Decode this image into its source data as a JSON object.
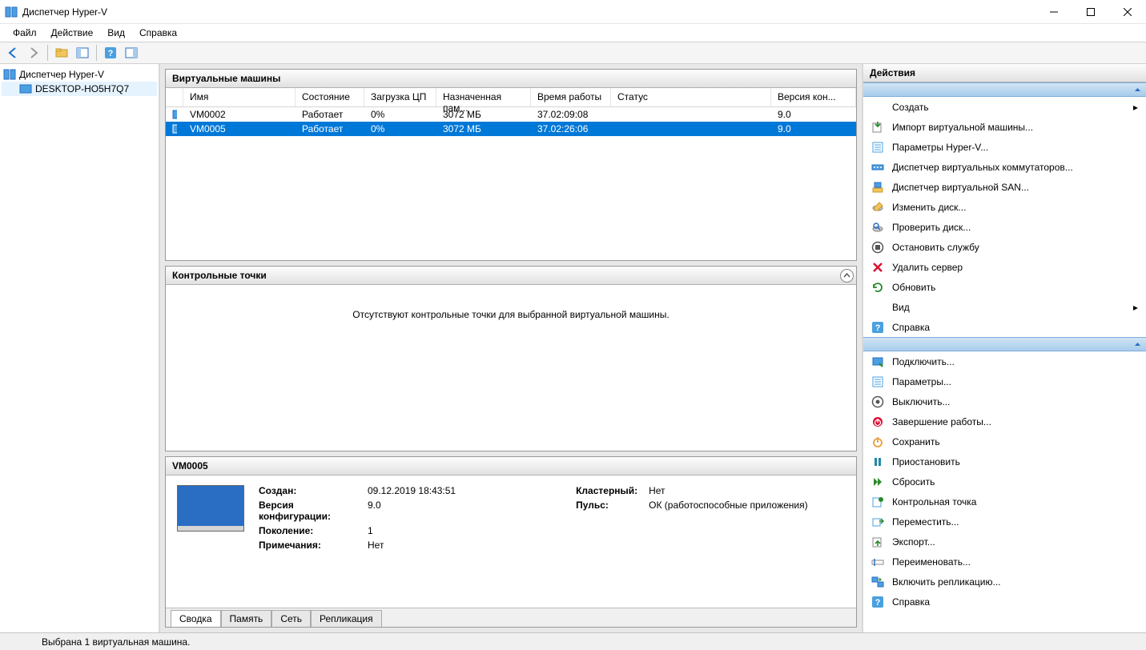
{
  "window": {
    "title": "Диспетчер Hyper-V"
  },
  "menu": {
    "file": "Файл",
    "action": "Действие",
    "view": "Вид",
    "help": "Справка"
  },
  "tree": {
    "root": "Диспетчер Hyper-V",
    "host": "DESKTOP-HO5H7Q7"
  },
  "vm_panel": {
    "title": "Виртуальные машины",
    "cols": {
      "name": "Имя",
      "state": "Состояние",
      "cpu": "Загрузка ЦП",
      "mem": "Назначенная пам...",
      "uptime": "Время работы",
      "status": "Статус",
      "version": "Версия кон..."
    },
    "rows": [
      {
        "name": "VM0002",
        "state": "Работает",
        "cpu": "0%",
        "mem": "3072 МБ",
        "uptime": "37.02:09:08",
        "status": "",
        "version": "9.0"
      },
      {
        "name": "VM0005",
        "state": "Работает",
        "cpu": "0%",
        "mem": "3072 МБ",
        "uptime": "37.02:26:06",
        "status": "",
        "version": "9.0"
      }
    ]
  },
  "cp_panel": {
    "title": "Контрольные точки",
    "empty_text": "Отсутствуют контрольные точки для выбранной виртуальной машины."
  },
  "details": {
    "vm_name": "VM0005",
    "labels": {
      "created": "Создан:",
      "config_version": "Версия конфигурации:",
      "generation": "Поколение:",
      "notes": "Примечания:",
      "clustered": "Кластерный:",
      "heartbeat": "Пульс:"
    },
    "values": {
      "created": "09.12.2019 18:43:51",
      "config_version": "9.0",
      "generation": "1",
      "notes": "Нет",
      "clustered": "Нет",
      "heartbeat": "ОК (работоспособные приложения)"
    },
    "tabs": {
      "summary": "Сводка",
      "memory": "Память",
      "network": "Сеть",
      "replication": "Репликация"
    }
  },
  "actions": {
    "title": "Действия",
    "host": [
      {
        "label": "Создать",
        "icon": "blank",
        "arrow": true
      },
      {
        "label": "Импорт виртуальной машины...",
        "icon": "import"
      },
      {
        "label": "Параметры Hyper-V...",
        "icon": "settings"
      },
      {
        "label": "Диспетчер виртуальных коммутаторов...",
        "icon": "switch"
      },
      {
        "label": "Диспетчер виртуальной SAN...",
        "icon": "san"
      },
      {
        "label": "Изменить диск...",
        "icon": "editdisk"
      },
      {
        "label": "Проверить диск...",
        "icon": "inspectdisk"
      },
      {
        "label": "Остановить службу",
        "icon": "stop"
      },
      {
        "label": "Удалить сервер",
        "icon": "delete"
      },
      {
        "label": "Обновить",
        "icon": "refresh"
      },
      {
        "label": "Вид",
        "icon": "blank",
        "arrow": true
      },
      {
        "label": "Справка",
        "icon": "help"
      }
    ],
    "vm": [
      {
        "label": "Подключить...",
        "icon": "connect"
      },
      {
        "label": "Параметры...",
        "icon": "settings"
      },
      {
        "label": "Выключить...",
        "icon": "turnoff"
      },
      {
        "label": "Завершение работы...",
        "icon": "shutdown"
      },
      {
        "label": "Сохранить",
        "icon": "save"
      },
      {
        "label": "Приостановить",
        "icon": "pause"
      },
      {
        "label": "Сбросить",
        "icon": "reset"
      },
      {
        "label": "Контрольная точка",
        "icon": "checkpoint"
      },
      {
        "label": "Переместить...",
        "icon": "move"
      },
      {
        "label": "Экспорт...",
        "icon": "export"
      },
      {
        "label": "Переименовать...",
        "icon": "rename"
      },
      {
        "label": "Включить репликацию...",
        "icon": "replication"
      },
      {
        "label": "Справка",
        "icon": "help"
      }
    ]
  },
  "statusbar": {
    "text": "Выбрана 1 виртуальная машина."
  }
}
